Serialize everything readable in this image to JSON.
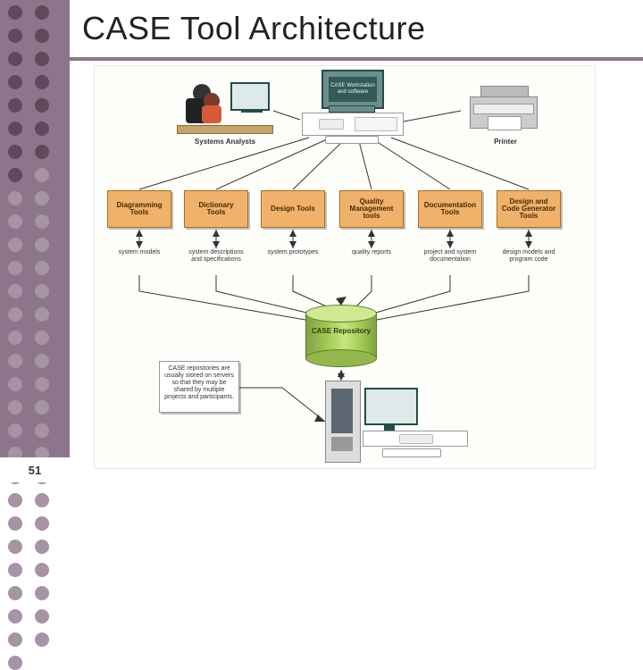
{
  "slide": {
    "title": "CASE Tool Architecture",
    "page_number": "51"
  },
  "top": {
    "analysts_label": "Systems Analysts",
    "workstation_caption": "CASE Workstation and software",
    "printer_label": "Printer"
  },
  "tools": [
    {
      "label": "Diagramming Tools",
      "sublabel": "system models"
    },
    {
      "label": "Dictionary Tools",
      "sublabel": "system descriptions and specifications"
    },
    {
      "label": "Design Tools",
      "sublabel": "system prototypes"
    },
    {
      "label": "Quality Management tools",
      "sublabel": "quality reports"
    },
    {
      "label": "Documentation Tools",
      "sublabel": "project and system documentation"
    },
    {
      "label": "Design and Code Generator Tools",
      "sublabel": "design models and program code"
    }
  ],
  "repository_label": "CASE Repository",
  "note_text": "CASE repositories are usually stored on servers so that they may be shared by multiple projects and participants."
}
